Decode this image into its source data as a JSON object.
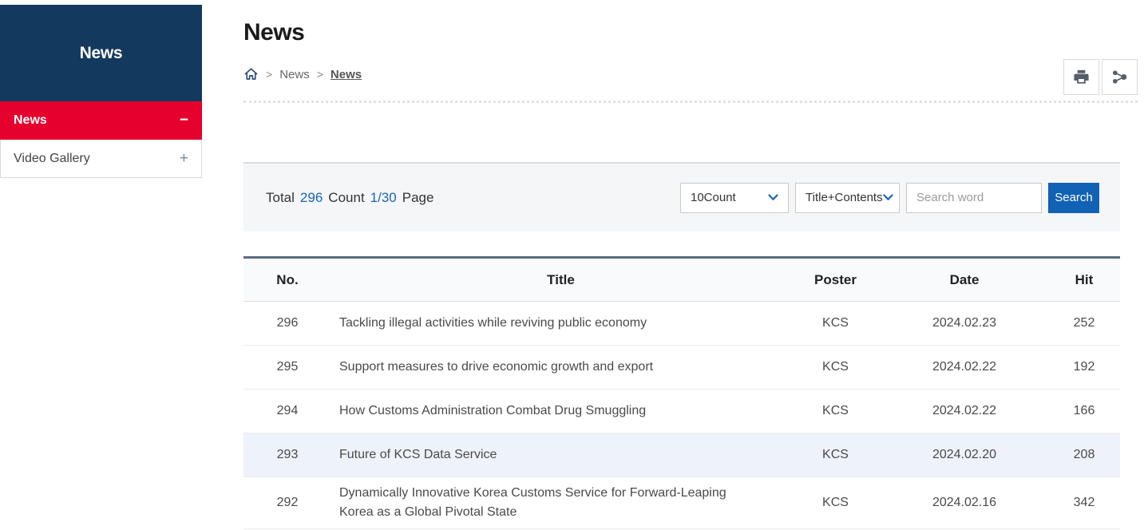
{
  "sidebar": {
    "title": "News",
    "items": [
      {
        "label": "News",
        "toggle": "−",
        "active": true
      },
      {
        "label": "Video Gallery",
        "toggle": "+",
        "active": false
      }
    ]
  },
  "page": {
    "title": "News",
    "breadcrumb": {
      "separator": ">",
      "items": [
        "News",
        "News"
      ]
    }
  },
  "icons": {
    "home": "home-icon",
    "print": "printer-icon",
    "share": "share-nodes-icon",
    "select_chevron": "chevron-down-icon",
    "collapse": "minus-icon",
    "expand": "plus-icon"
  },
  "listbar": {
    "total_label": "Total",
    "total_value": "296",
    "count_label": "Count",
    "page_value": "1/30",
    "page_label": "Page",
    "count_select": "10Count",
    "field_select": "Title+Contents",
    "search_placeholder": "Search word",
    "search_button": "Search"
  },
  "table": {
    "headers": [
      "No.",
      "Title",
      "Poster",
      "Date",
      "Hit"
    ],
    "rows": [
      {
        "no": "296",
        "title": "Tackling illegal activities while reviving public economy",
        "poster": "KCS",
        "date": "2024.02.23",
        "hit": "252"
      },
      {
        "no": "295",
        "title": "Support measures to drive economic growth and export",
        "poster": "KCS",
        "date": "2024.02.22",
        "hit": "192"
      },
      {
        "no": "294",
        "title": "How Customs Administration Combat Drug Smuggling",
        "poster": "KCS",
        "date": "2024.02.22",
        "hit": "166"
      },
      {
        "no": "293",
        "title": "Future of KCS Data Service",
        "poster": "KCS",
        "date": "2024.02.20",
        "hit": "208"
      },
      {
        "no": "292",
        "title": "Dynamically Innovative Korea Customs Service for Forward-Leaping Korea as a Global Pivotal State",
        "poster": "KCS",
        "date": "2024.02.16",
        "hit": "342"
      }
    ]
  },
  "colors": {
    "sidebar_navy": "#14395e",
    "active_red": "#e6002d",
    "accent_blue": "#1b64ba",
    "search_button_blue": "#1161b5",
    "table_top_border": "#5b6b7f",
    "toolbar_bg": "#f4f6f8",
    "highlight_row_bg": "#eef2fa"
  }
}
